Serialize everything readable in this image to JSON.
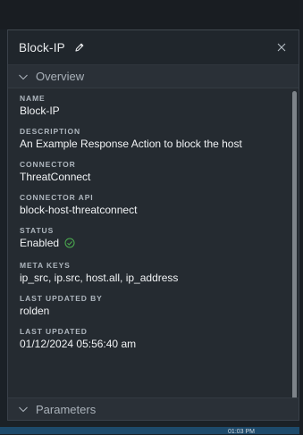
{
  "panel": {
    "title": "Block-IP",
    "overview_label": "Overview",
    "parameters_label": "Parameters"
  },
  "fields": {
    "name_label": "NAME",
    "name_value": "Block-IP",
    "description_label": "DESCRIPTION",
    "description_value": "An Example Response Action to block the host",
    "connector_label": "CONNECTOR",
    "connector_value": "ThreatConnect",
    "connector_api_label": "CONNECTOR API",
    "connector_api_value": "block-host-threatconnect",
    "status_label": "STATUS",
    "status_value": "Enabled",
    "meta_keys_label": "META KEYS",
    "meta_keys_value": "ip_src, ip.src, host.all, ip_address",
    "last_updated_by_label": "LAST UPDATED BY",
    "last_updated_by_value": "rolden",
    "last_updated_label": "LAST UPDATED",
    "last_updated_value": "01/12/2024 05:56:40 am"
  },
  "taskbar": {
    "clock": "01:03 PM"
  },
  "icons": {
    "edit": "pencil-icon",
    "close": "close-icon",
    "expand": "chevron-down-icon",
    "status": "check-circle-icon"
  },
  "colors": {
    "panel_bg": "#252b31",
    "enabled_green": "#4caf50"
  }
}
